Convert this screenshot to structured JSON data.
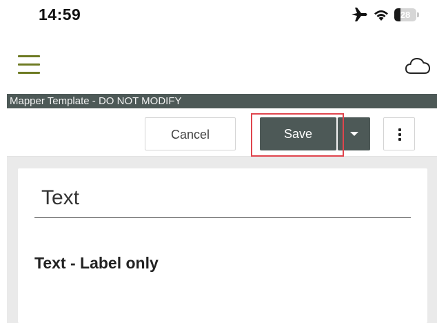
{
  "status_bar": {
    "time": "14:59",
    "icons": [
      "airplane-icon",
      "wifi-icon",
      "battery-icon"
    ],
    "battery_level": "28"
  },
  "app_bar": {
    "menu_icon": "hamburger-menu-icon",
    "sync_icon": "cloud-icon",
    "accent_color": "#6d7a22"
  },
  "title_strip": {
    "title": "Mapper Template - DO NOT MODIFY",
    "background": "#4d5957"
  },
  "toolbar": {
    "cancel_label": "Cancel",
    "save_label": "Save",
    "dropdown_icon": "caret-down-icon",
    "more_icon": "more-vertical-icon",
    "highlight_color": "#e0454d"
  },
  "form": {
    "text_field_label": "Text",
    "label_only_text": "Text - Label only"
  }
}
